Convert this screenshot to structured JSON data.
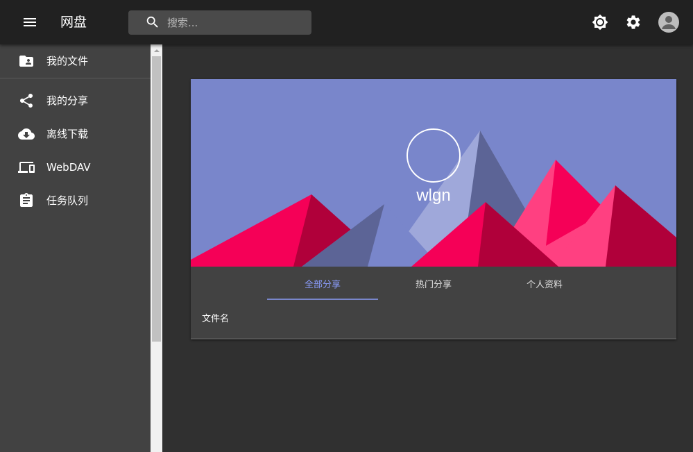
{
  "app": {
    "title": "网盘"
  },
  "search": {
    "placeholder": "搜索..."
  },
  "toolbar": {
    "icons": [
      "menu-icon",
      "search-icon",
      "brightness-icon",
      "gear-icon",
      "account-icon"
    ]
  },
  "sidebar": {
    "items": [
      {
        "label": "我的文件",
        "icon": "folder-shared-icon"
      },
      {
        "label": "我的分享",
        "icon": "share-icon"
      },
      {
        "label": "离线下载",
        "icon": "cloud-download-icon"
      },
      {
        "label": "WebDAV",
        "icon": "devices-icon"
      },
      {
        "label": "任务队列",
        "icon": "assignment-icon"
      }
    ]
  },
  "profile": {
    "username": "wlgn",
    "banner_colors": {
      "sky": "#7986cb",
      "primary": "#f50057",
      "dark": "#5c6496"
    },
    "tabs": [
      {
        "label": "全部分享",
        "active": true
      },
      {
        "label": "热门分享",
        "active": false
      },
      {
        "label": "个人资料",
        "active": false
      }
    ],
    "table": {
      "columns": [
        "文件名"
      ]
    }
  },
  "colors": {
    "accent": "#7986cb",
    "appbar": "#212121",
    "sidebar": "#424242",
    "background": "#303030"
  }
}
